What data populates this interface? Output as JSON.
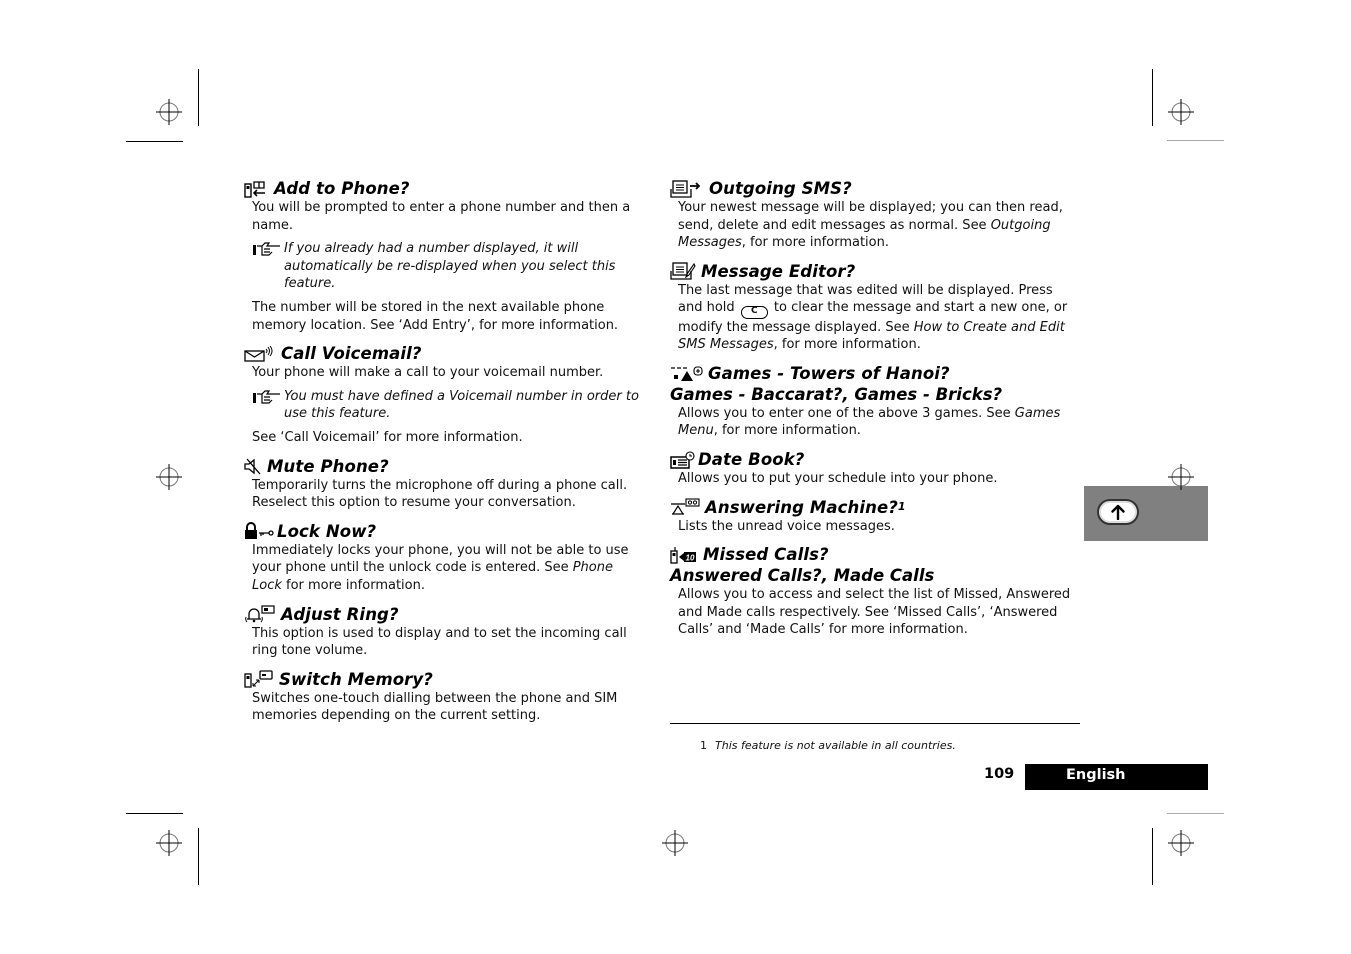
{
  "page": {
    "number": "109",
    "language": "English",
    "tab_icon": "up-arrow-key-icon"
  },
  "left_column": [
    {
      "icon": "add-to-phone-icon",
      "title": "Add to Phone?",
      "body1": "You will be prompted to enter a phone number and then a name.",
      "note": "If you already had a number displayed, it will automatically be re-displayed when you select this feature.",
      "body2": "The number will be stored in the next available phone memory location. See ‘Add Entry’, for more information."
    },
    {
      "icon": "voicemail-icon",
      "title": "Call Voicemail?",
      "body1": "Your phone will make a call to your voicemail number.",
      "note": "You must have defined a Voicemail number in order to use this feature.",
      "body2": "See ‘Call Voicemail’ for more information."
    },
    {
      "icon": "mute-icon",
      "title": "Mute Phone?",
      "body1": "Temporarily turns the microphone off during a phone call. Reselect this option to resume your conversation."
    },
    {
      "icon": "lock-key-icon",
      "title": "Lock Now?",
      "body1_pre": "Immediately locks your phone, you will not be able to use your phone until the unlock code is entered. See ",
      "body1_em": "Phone Lock",
      "body1_post": " for more information."
    },
    {
      "icon": "ring-bell-icon",
      "title": "Adjust Ring?",
      "body1": "This option is used to display and to set the incoming call ring tone volume."
    },
    {
      "icon": "switch-memory-icon",
      "title": "Switch Memory?",
      "body1": "Switches one-touch dialling between the phone and SIM memories depending on the current setting."
    }
  ],
  "right_column": [
    {
      "icon": "outgoing-sms-icon",
      "title": "Outgoing SMS?",
      "body1_pre": "Your newest message will be displayed; you can then read, send, delete and edit messages as normal. See ",
      "body1_em": "Outgoing Messages",
      "body1_post": ", for more information."
    },
    {
      "icon": "message-editor-icon",
      "title": "Message Editor?",
      "body1_pre": "The last message that was edited will be displayed. Press and hold ",
      "key_label": "C",
      "body1_mid": " to clear the message and start a new one, or modify the message displayed. See ",
      "body1_em": "How to Create and Edit SMS Messages",
      "body1_post": ", for more information."
    },
    {
      "icon": "games-icon",
      "title": "Games - Towers of Hanoi?",
      "title2": "Games - Baccarat?, Games - Bricks?",
      "body1_pre": "Allows you to enter one of the above 3 games. See ",
      "body1_em": "Games Menu",
      "body1_post": ", for more information."
    },
    {
      "icon": "date-book-icon",
      "title": "Date Book?",
      "body1": "Allows you to put your schedule into your phone."
    },
    {
      "icon": "answering-machine-icon",
      "title": "Answering Machine?",
      "footnote_ref": "1",
      "body1": "Lists the unread voice messages."
    },
    {
      "icon": "missed-calls-icon",
      "title": "Missed Calls?",
      "title2": "Answered Calls?, Made Calls",
      "body1": "Allows you to access and select the list of Missed, Answered and Made calls respectively. See ‘Missed Calls’, ‘Answered Calls’ and ‘Made Calls’ for more information."
    }
  ],
  "footnote": {
    "number": "1",
    "text": "This feature is not available in all countries."
  }
}
